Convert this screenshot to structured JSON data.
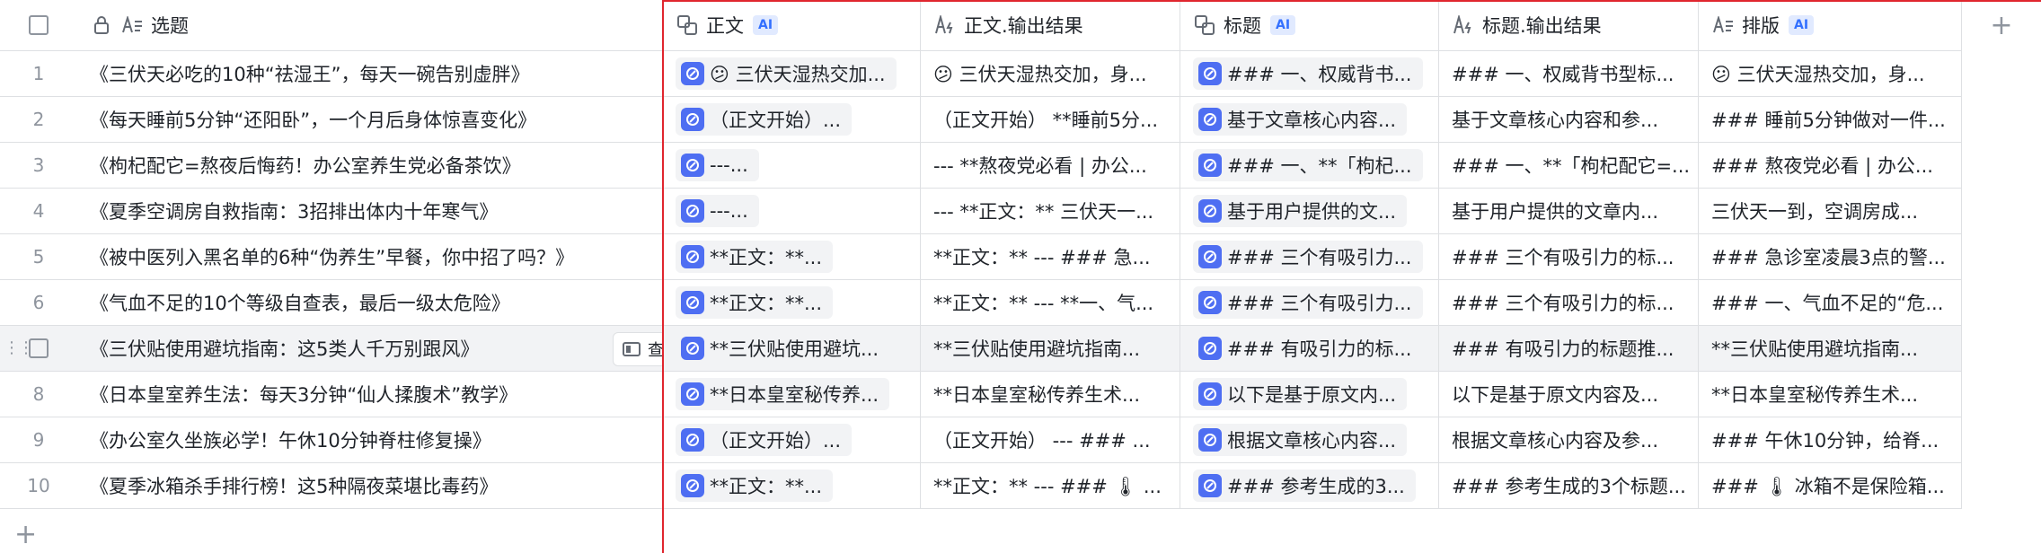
{
  "header": {
    "title_col": "选题",
    "cols": [
      {
        "label": "正文",
        "ai": "AI",
        "icon": "ai-link-icon"
      },
      {
        "label": "正文.输出结果",
        "ai": "",
        "icon": "ai-text-icon"
      },
      {
        "label": "标题",
        "ai": "AI",
        "icon": "ai-link-icon"
      },
      {
        "label": "标题.输出结果",
        "ai": "",
        "icon": "ai-text-icon"
      },
      {
        "label": "排版",
        "ai": "AI",
        "icon": "text-icon"
      }
    ],
    "add_column": "+"
  },
  "hover_row": {
    "view_label": "查看",
    "add": "+"
  },
  "add_row": "+",
  "rows": [
    {
      "n": "1",
      "title": "《三伏天必吃的10种“祛湿王”，每天一碗告别虚胖》",
      "c1": "😕 三伏天湿热交加...",
      "c2": "😕 三伏天湿热交加，身...",
      "c3": "### 一、权威背书...",
      "c4": "### 一、权威背书型标...",
      "c5": "😕 三伏天湿热交加，身..."
    },
    {
      "n": "2",
      "title": "《每天睡前5分钟“还阳卧”，一个月后身体惊喜变化》",
      "c1": "（正文开始）...",
      "c2": "（正文开始） **睡前5分...",
      "c3": "基于文章核心内容...",
      "c4": "基于文章核心内容和参...",
      "c5": "### 睡前5分钟做对一件..."
    },
    {
      "n": "3",
      "title": "《枸杞配它=熬夜后悔药！办公室养生党必备茶饮》",
      "c1": "---...",
      "c2": "--- **熬夜党必看 | 办公...",
      "c3": "### 一、**「枸杞...",
      "c4": "### 一、**「枸杞配它=...",
      "c5": "### 熬夜党必看 | 办公..."
    },
    {
      "n": "4",
      "title": "《夏季空调房自救指南：3招排出体内十年寒气》",
      "c1": "---...",
      "c2": "--- **正文：** 三伏天一...",
      "c3": "基于用户提供的文...",
      "c4": "基于用户提供的文章内...",
      "c5": "三伏天一到，空调房成..."
    },
    {
      "n": "5",
      "title": "《被中医列入黑名单的6种“伪养生”早餐，你中招了吗？》",
      "c1": "**正文：**...",
      "c2": "**正文：** --- ### 急...",
      "c3": "### 三个有吸引力...",
      "c4": "### 三个有吸引力的标...",
      "c5": "### 急诊室凌晨3点的警..."
    },
    {
      "n": "6",
      "title": "《气血不足的10个等级自查表，最后一级太危险》",
      "c1": "**正文：**...",
      "c2": "**正文：** --- **一、气...",
      "c3": "### 三个有吸引力...",
      "c4": "### 三个有吸引力的标...",
      "c5": "### 一、气血不足的“危..."
    },
    {
      "n": "7",
      "title": "《三伏贴使用避坑指南：这5类人千万别跟风》",
      "c1": "**三伏贴使用避坑...",
      "c2": "**三伏贴使用避坑指南...",
      "c3": "### 有吸引力的标...",
      "c4": "### 有吸引力的标题推...",
      "c5": "**三伏贴使用避坑指南..."
    },
    {
      "n": "8",
      "title": "《日本皇室养生法：每天3分钟“仙人揉腹术”教学》",
      "c1": "**日本皇室秘传养...",
      "c2": "**日本皇室秘传养生术...",
      "c3": "以下是基于原文内...",
      "c4": "以下是基于原文内容及...",
      "c5": "**日本皇室秘传养生术..."
    },
    {
      "n": "9",
      "title": "《办公室久坐族必学！午休10分钟脊柱修复操》",
      "c1": "（正文开始）...",
      "c2": "（正文开始） --- ### ...",
      "c3": "根据文章核心内容...",
      "c4": "根据文章核心内容及参...",
      "c5": "### 午休10分钟，给脊..."
    },
    {
      "n": "10",
      "title": "《夏季冰箱杀手排行榜！这5种隔夜菜堪比毒药》",
      "c1": "**正文：**...",
      "c2": "**正文：** --- ### 🌡 ...",
      "c3": "### 参考生成的3...",
      "c4": "### 参考生成的3个标题...",
      "c5": "### 🌡 冰箱不是保险箱..."
    }
  ]
}
